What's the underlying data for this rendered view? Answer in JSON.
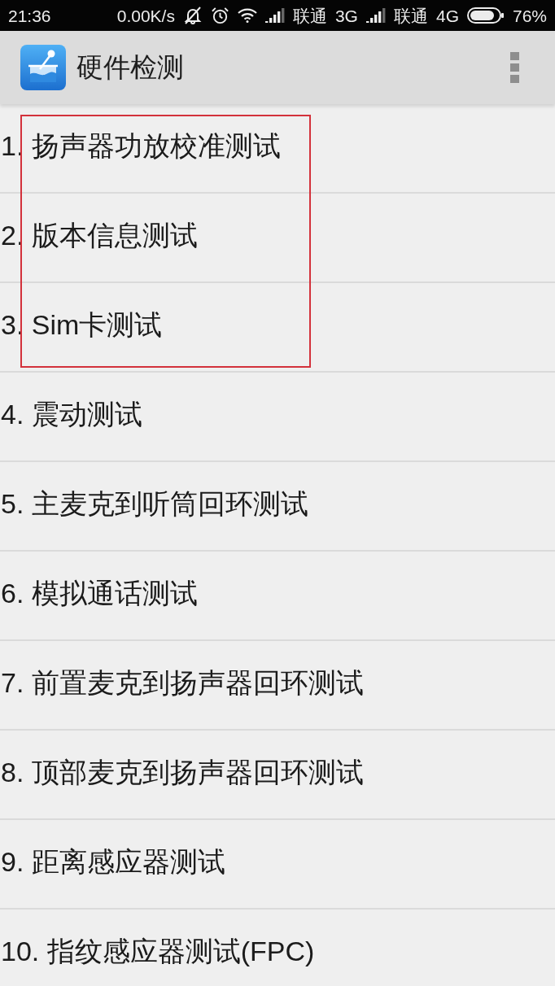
{
  "status_bar": {
    "time": "21:36",
    "network_speed": "0.00K/s",
    "carriers": [
      {
        "name": "联通",
        "network": "3G"
      },
      {
        "name": "联通",
        "network": "4G"
      }
    ],
    "battery": "76%"
  },
  "app_bar": {
    "title": "硬件检测"
  },
  "tests": [
    {
      "text": "1. 扬声器功放校准测试",
      "highlighted": true
    },
    {
      "text": "2. 版本信息测试",
      "highlighted": true
    },
    {
      "text": "3. Sim卡测试",
      "highlighted": true
    },
    {
      "text": "4. 震动测试",
      "highlighted": false
    },
    {
      "text": "5. 主麦克到听筒回环测试",
      "highlighted": false
    },
    {
      "text": "6. 模拟通话测试",
      "highlighted": false
    },
    {
      "text": "7. 前置麦克到扬声器回环测试",
      "highlighted": false
    },
    {
      "text": "8. 顶部麦克到扬声器回环测试",
      "highlighted": false
    },
    {
      "text": "9. 距离感应器测试",
      "highlighted": false
    },
    {
      "text": "10. 指纹感应器测试(FPC)",
      "highlighted": false
    }
  ]
}
